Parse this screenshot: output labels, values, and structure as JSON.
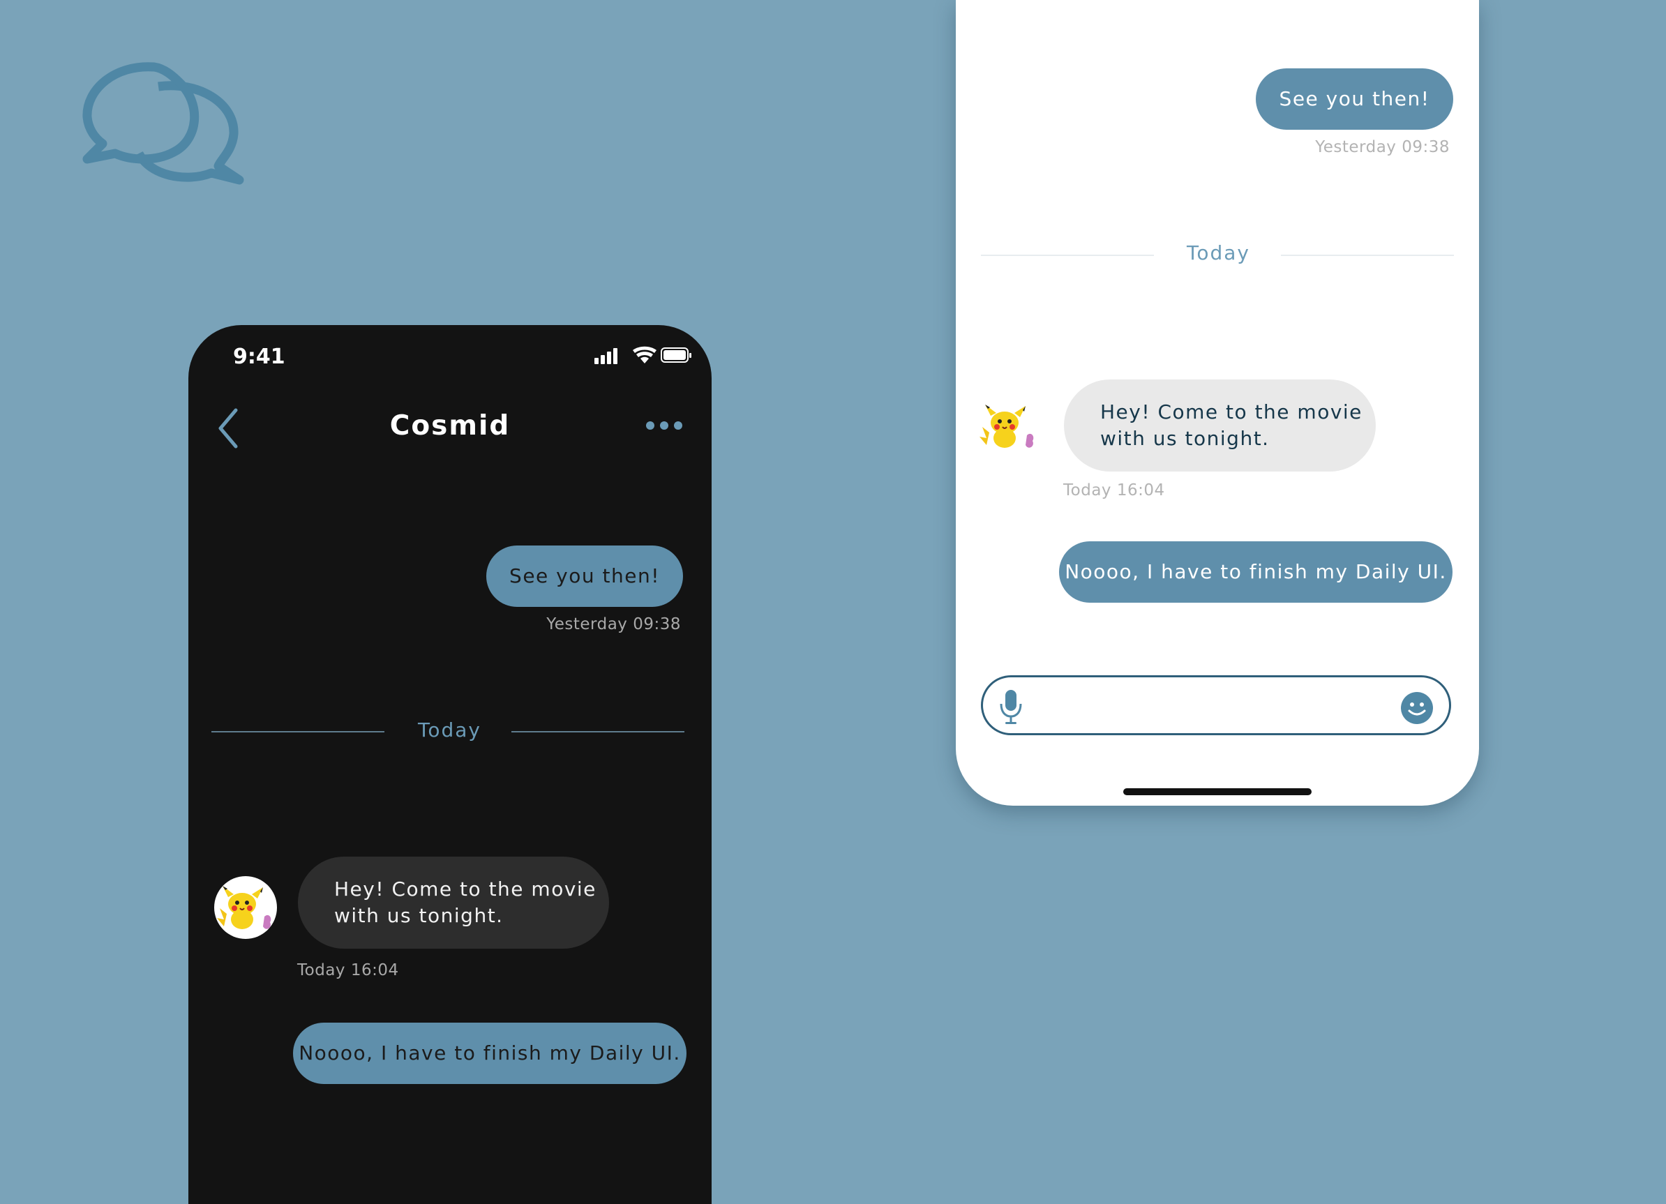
{
  "colors": {
    "background": "#7aa3b9",
    "accent": "#5f8fab",
    "dark_bg": "#131313",
    "incoming_dark": "#2d2d2d",
    "incoming_light": "#e9e9e9"
  },
  "icons": [
    "chat-bubbles-icon",
    "back-chevron-icon",
    "more-dots-icon",
    "signal-icon",
    "wifi-icon",
    "battery-icon",
    "microphone-icon",
    "smiley-icon",
    "pikachu-avatar"
  ],
  "dark_phone": {
    "status_time": "9:41",
    "title": "Cosmid",
    "messages": [
      {
        "text": "See you then!",
        "time": "Yesterday 09:38"
      },
      {
        "text_line1": "Hey! Come to the movie",
        "text_line2": "with us  tonight.",
        "time": "Today 16:04"
      },
      {
        "text": "Noooo, I have to finish my Daily UI."
      }
    ],
    "divider": "Today"
  },
  "light_phone": {
    "messages": [
      {
        "text": "See you then!",
        "time": "Yesterday 09:38"
      },
      {
        "text_line1": "Hey! Come to the movie",
        "text_line2": "with us  tonight.",
        "time": "Today 16:04"
      },
      {
        "text": "Noooo, I have to finish my Daily UI."
      }
    ],
    "divider": "Today",
    "input_value": ""
  }
}
